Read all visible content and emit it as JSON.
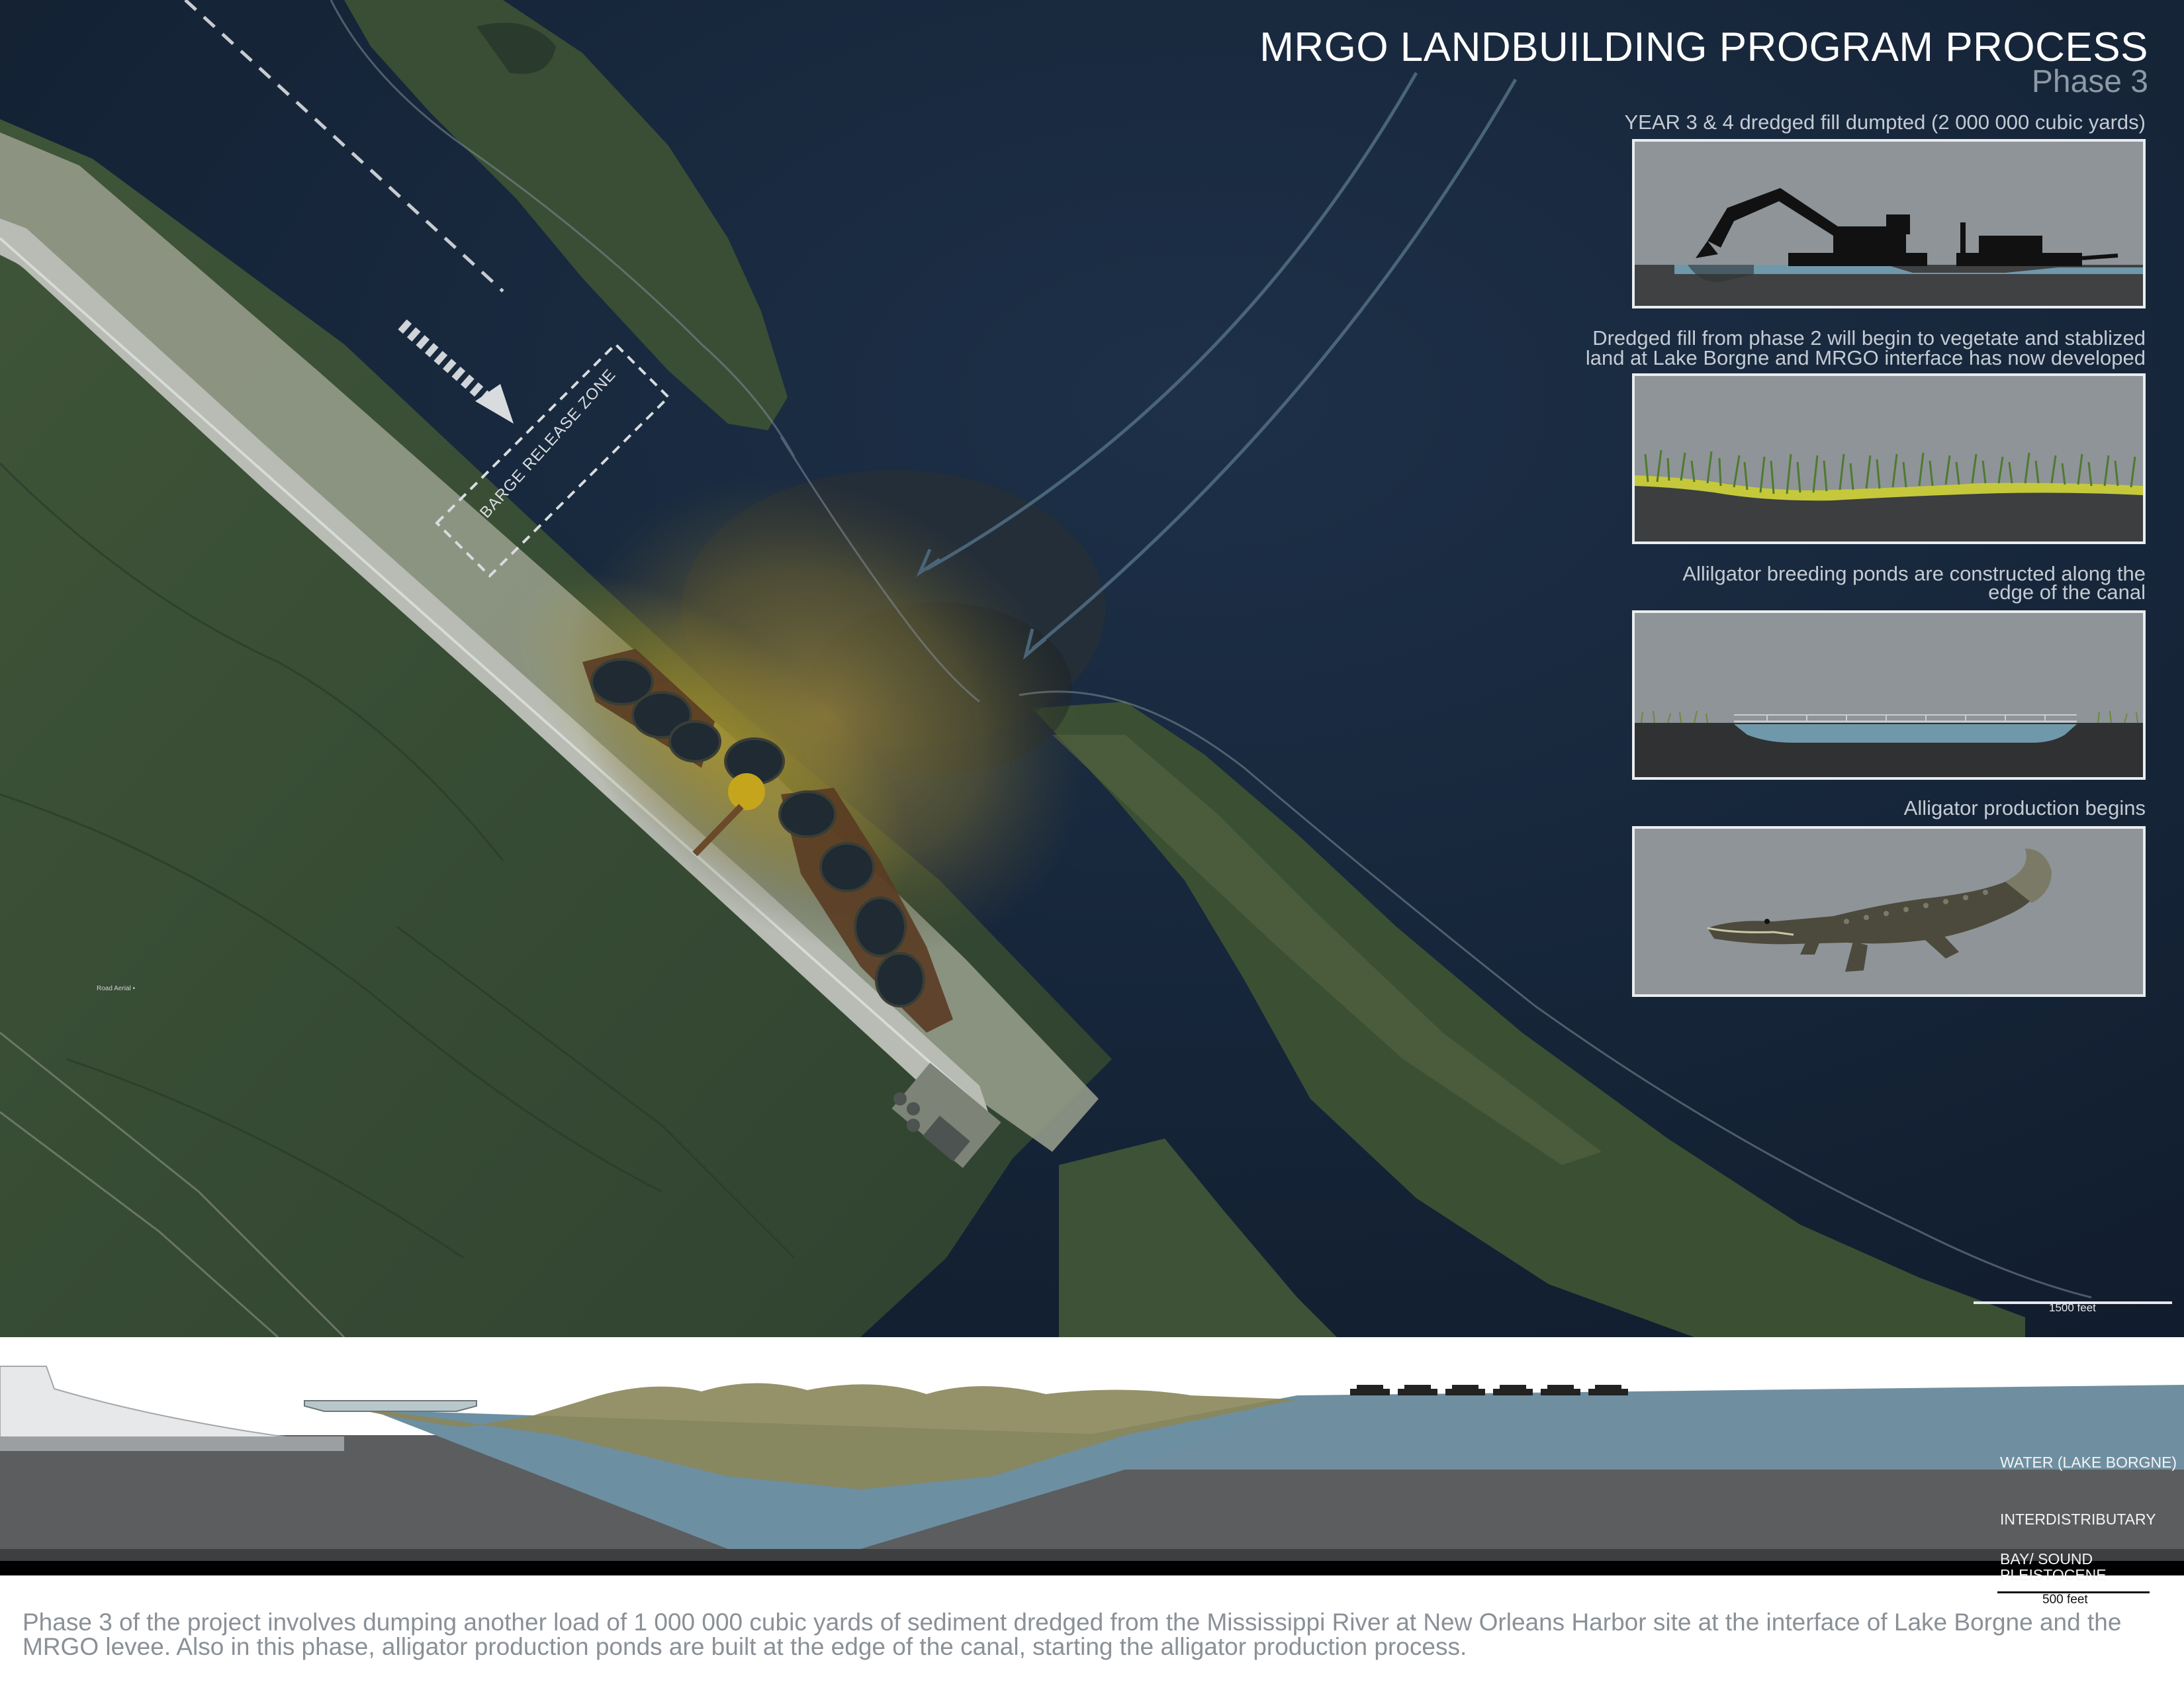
{
  "title": "MRGO LANDBUILDING PROGRAM PROCESS",
  "subtitle": "Phase 3",
  "map": {
    "zone_label": "BARGE RELEASE ZONE",
    "scale_label": "1500 feet",
    "road_label": "Road  Aerial •"
  },
  "panels": [
    {
      "caption": "YEAR 3 & 4 dredged fill dumpted (2 000 000 cubic yards)",
      "icon": "dredge-excavator-barge"
    },
    {
      "caption_line1": "Dredged fill from phase 2 will begin to vegetate and stablized",
      "caption_line2": "land at Lake Borgne and MRGO interface has now developed",
      "icon": "vegetation"
    },
    {
      "caption_line1": "Allilgator breeding ponds are constructed along the",
      "caption_line2": "edge of the canal",
      "icon": "breeding-pond"
    },
    {
      "caption": "Alligator production begins",
      "icon": "alligator"
    }
  ],
  "section": {
    "layers": [
      "WATER (LAKE BORGNE)",
      "INTERDISTRIBUTARY",
      "BAY/ SOUND",
      "PLEISTOCENE"
    ],
    "scale_label": "500 feet"
  },
  "description": "Phase 3 of the project involves dumping another load of 1 000 000 cubic yards of sediment dredged from the Mississippi River at New Orleans Harbor site at the interface of Lake Borgne and the MRGO levee.  Also in this phase, alligator production ponds are built at the edge of the canal, starting the alligator production process.",
  "colors": {
    "water": "#17263a",
    "marsh": "#3d5236",
    "sediment": "#8a7a36",
    "section_water": "#6f8fa0",
    "interdistributary": "#5c5d5f",
    "panel_bg": "#8c9296"
  }
}
